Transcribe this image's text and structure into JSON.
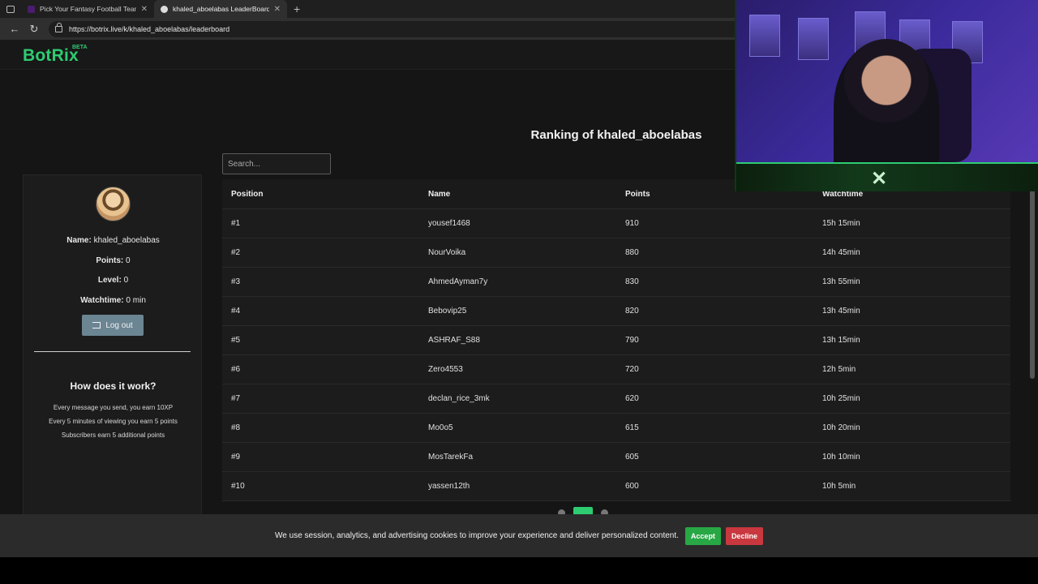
{
  "browser": {
    "tabs": [
      {
        "title": "Pick Your Fantasy Football Team |",
        "active": false
      },
      {
        "title": "khaled_aboelabas LeaderBoard |",
        "active": true
      }
    ],
    "url": "https://botrix.live/k/khaled_aboelabas/leaderboard"
  },
  "brand": {
    "name": "BotRix",
    "badge": "BETA",
    "accent": "#2ecc71"
  },
  "page": {
    "title": "Ranking of khaled_aboelabas"
  },
  "search": {
    "placeholder": "Search..."
  },
  "profile": {
    "name_label": "Name:",
    "name_value": "khaled_aboelabas",
    "points_label": "Points:",
    "points_value": "0",
    "level_label": "Level:",
    "level_value": "0",
    "watchtime_label": "Watchtime:",
    "watchtime_value": "0 min",
    "logout_label": "Log out"
  },
  "how": {
    "title": "How does it work?",
    "lines": [
      "Every message you send, you earn 10XP",
      "Every 5 minutes of viewing you earn 5 points",
      "Subscribers earn 5 additional points"
    ]
  },
  "table": {
    "headers": [
      "Position",
      "Name",
      "Points",
      "Watchtime"
    ],
    "rows": [
      [
        "#1",
        "yousef1468",
        "910",
        "15h 15min"
      ],
      [
        "#2",
        "NourVoika",
        "880",
        "14h 45min"
      ],
      [
        "#3",
        "AhmedAyman7y",
        "830",
        "13h 55min"
      ],
      [
        "#4",
        "Bebovip25",
        "820",
        "13h 45min"
      ],
      [
        "#5",
        "ASHRAF_S88",
        "790",
        "13h 15min"
      ],
      [
        "#6",
        "Zero4553",
        "720",
        "12h 5min"
      ],
      [
        "#7",
        "declan_rice_3mk",
        "620",
        "10h 25min"
      ],
      [
        "#8",
        "Mo0o5",
        "615",
        "10h 20min"
      ],
      [
        "#9",
        "MosTarekFa",
        "605",
        "10h 10min"
      ],
      [
        "#10",
        "yassen12th",
        "600",
        "10h 5min"
      ]
    ]
  },
  "cookie": {
    "text": "We use session, analytics, and advertising cookies to improve your experience and deliver personalized content.",
    "accept": "Accept",
    "decline": "Decline"
  }
}
